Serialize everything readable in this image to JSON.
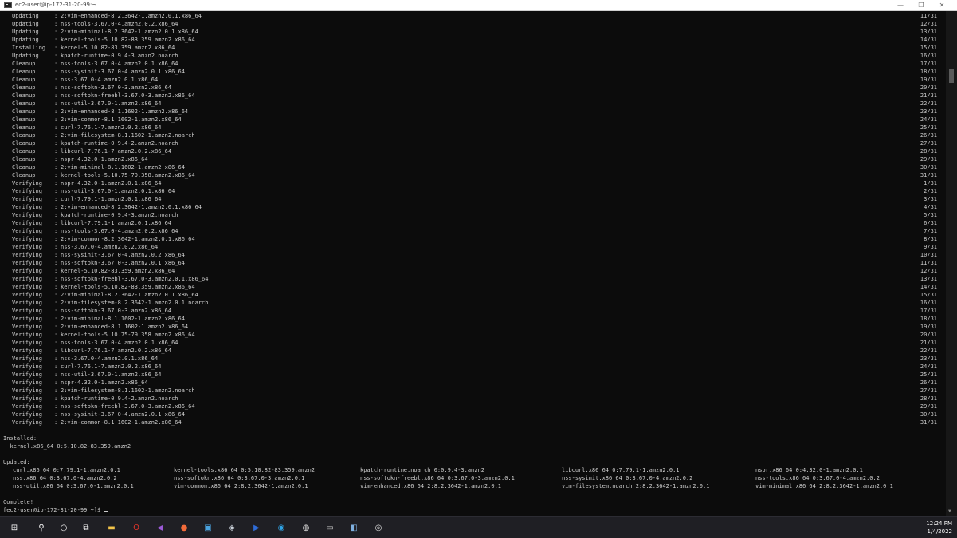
{
  "window": {
    "title": "ec2-user@ip-172-31-20-99:~",
    "minimize_label": "—",
    "maximize_label": "❐",
    "close_label": "✕"
  },
  "terminal": {
    "lines": [
      {
        "action": "Updating",
        "pkg": "2:vim-enhanced-8.2.3642-1.amzn2.0.1.x86_64",
        "count": "11/31"
      },
      {
        "action": "Updating",
        "pkg": "nss-tools-3.67.0-4.amzn2.0.2.x86_64",
        "count": "12/31"
      },
      {
        "action": "Updating",
        "pkg": "2:vim-minimal-8.2.3642-1.amzn2.0.1.x86_64",
        "count": "13/31"
      },
      {
        "action": "Updating",
        "pkg": "kernel-tools-5.10.82-83.359.amzn2.x86_64",
        "count": "14/31"
      },
      {
        "action": "Installing",
        "pkg": "kernel-5.10.82-83.359.amzn2.x86_64",
        "count": "15/31"
      },
      {
        "action": "Updating",
        "pkg": "kpatch-runtime-0.9.4-3.amzn2.noarch",
        "count": "16/31"
      },
      {
        "action": "Cleanup",
        "pkg": "nss-tools-3.67.0-4.amzn2.0.1.x86_64",
        "count": "17/31"
      },
      {
        "action": "Cleanup",
        "pkg": "nss-sysinit-3.67.0-4.amzn2.0.1.x86_64",
        "count": "18/31"
      },
      {
        "action": "Cleanup",
        "pkg": "nss-3.67.0-4.amzn2.0.1.x86_64",
        "count": "19/31"
      },
      {
        "action": "Cleanup",
        "pkg": "nss-softokn-3.67.0-3.amzn2.x86_64",
        "count": "20/31"
      },
      {
        "action": "Cleanup",
        "pkg": "nss-softokn-freebl-3.67.0-3.amzn2.x86_64",
        "count": "21/31"
      },
      {
        "action": "Cleanup",
        "pkg": "nss-util-3.67.0-1.amzn2.x86_64",
        "count": "22/31"
      },
      {
        "action": "Cleanup",
        "pkg": "2:vim-enhanced-8.1.1602-1.amzn2.x86_64",
        "count": "23/31"
      },
      {
        "action": "Cleanup",
        "pkg": "2:vim-common-8.1.1602-1.amzn2.x86_64",
        "count": "24/31"
      },
      {
        "action": "Cleanup",
        "pkg": "curl-7.76.1-7.amzn2.0.2.x86_64",
        "count": "25/31"
      },
      {
        "action": "Cleanup",
        "pkg": "2:vim-filesystem-8.1.1602-1.amzn2.noarch",
        "count": "26/31"
      },
      {
        "action": "Cleanup",
        "pkg": "kpatch-runtime-0.9.4-2.amzn2.noarch",
        "count": "27/31"
      },
      {
        "action": "Cleanup",
        "pkg": "libcurl-7.76.1-7.amzn2.0.2.x86_64",
        "count": "28/31"
      },
      {
        "action": "Cleanup",
        "pkg": "nspr-4.32.0-1.amzn2.x86_64",
        "count": "29/31"
      },
      {
        "action": "Cleanup",
        "pkg": "2:vim-minimal-8.1.1602-1.amzn2.x86_64",
        "count": "30/31"
      },
      {
        "action": "Cleanup",
        "pkg": "kernel-tools-5.10.75-79.358.amzn2.x86_64",
        "count": "31/31"
      },
      {
        "action": "Verifying",
        "pkg": "nspr-4.32.0-1.amzn2.0.1.x86_64",
        "count": "1/31"
      },
      {
        "action": "Verifying",
        "pkg": "nss-util-3.67.0-1.amzn2.0.1.x86_64",
        "count": "2/31"
      },
      {
        "action": "Verifying",
        "pkg": "curl-7.79.1-1.amzn2.0.1.x86_64",
        "count": "3/31"
      },
      {
        "action": "Verifying",
        "pkg": "2:vim-enhanced-8.2.3642-1.amzn2.0.1.x86_64",
        "count": "4/31"
      },
      {
        "action": "Verifying",
        "pkg": "kpatch-runtime-0.9.4-3.amzn2.noarch",
        "count": "5/31"
      },
      {
        "action": "Verifying",
        "pkg": "libcurl-7.79.1-1.amzn2.0.1.x86_64",
        "count": "6/31"
      },
      {
        "action": "Verifying",
        "pkg": "nss-tools-3.67.0-4.amzn2.0.2.x86_64",
        "count": "7/31"
      },
      {
        "action": "Verifying",
        "pkg": "2:vim-common-8.2.3642-1.amzn2.0.1.x86_64",
        "count": "8/31"
      },
      {
        "action": "Verifying",
        "pkg": "nss-3.67.0-4.amzn2.0.2.x86_64",
        "count": "9/31"
      },
      {
        "action": "Verifying",
        "pkg": "nss-sysinit-3.67.0-4.amzn2.0.2.x86_64",
        "count": "10/31"
      },
      {
        "action": "Verifying",
        "pkg": "nss-softokn-3.67.0-3.amzn2.0.1.x86_64",
        "count": "11/31"
      },
      {
        "action": "Verifying",
        "pkg": "kernel-5.10.82-83.359.amzn2.x86_64",
        "count": "12/31"
      },
      {
        "action": "Verifying",
        "pkg": "nss-softokn-freebl-3.67.0-3.amzn2.0.1.x86_64",
        "count": "13/31"
      },
      {
        "action": "Verifying",
        "pkg": "kernel-tools-5.10.82-83.359.amzn2.x86_64",
        "count": "14/31"
      },
      {
        "action": "Verifying",
        "pkg": "2:vim-minimal-8.2.3642-1.amzn2.0.1.x86_64",
        "count": "15/31"
      },
      {
        "action": "Verifying",
        "pkg": "2:vim-filesystem-8.2.3642-1.amzn2.0.1.noarch",
        "count": "16/31"
      },
      {
        "action": "Verifying",
        "pkg": "nss-softokn-3.67.0-3.amzn2.x86_64",
        "count": "17/31"
      },
      {
        "action": "Verifying",
        "pkg": "2:vim-minimal-8.1.1602-1.amzn2.x86_64",
        "count": "18/31"
      },
      {
        "action": "Verifying",
        "pkg": "2:vim-enhanced-8.1.1602-1.amzn2.x86_64",
        "count": "19/31"
      },
      {
        "action": "Verifying",
        "pkg": "kernel-tools-5.10.75-79.358.amzn2.x86_64",
        "count": "20/31"
      },
      {
        "action": "Verifying",
        "pkg": "nss-tools-3.67.0-4.amzn2.0.1.x86_64",
        "count": "21/31"
      },
      {
        "action": "Verifying",
        "pkg": "libcurl-7.76.1-7.amzn2.0.2.x86_64",
        "count": "22/31"
      },
      {
        "action": "Verifying",
        "pkg": "nss-3.67.0-4.amzn2.0.1.x86_64",
        "count": "23/31"
      },
      {
        "action": "Verifying",
        "pkg": "curl-7.76.1-7.amzn2.0.2.x86_64",
        "count": "24/31"
      },
      {
        "action": "Verifying",
        "pkg": "nss-util-3.67.0-1.amzn2.x86_64",
        "count": "25/31"
      },
      {
        "action": "Verifying",
        "pkg": "nspr-4.32.0-1.amzn2.x86_64",
        "count": "26/31"
      },
      {
        "action": "Verifying",
        "pkg": "2:vim-filesystem-8.1.1602-1.amzn2.noarch",
        "count": "27/31"
      },
      {
        "action": "Verifying",
        "pkg": "kpatch-runtime-0.9.4-2.amzn2.noarch",
        "count": "28/31"
      },
      {
        "action": "Verifying",
        "pkg": "nss-softokn-freebl-3.67.0-3.amzn2.x86_64",
        "count": "29/31"
      },
      {
        "action": "Verifying",
        "pkg": "nss-sysinit-3.67.0-4.amzn2.0.1.x86_64",
        "count": "30/31"
      },
      {
        "action": "Verifying",
        "pkg": "2:vim-common-8.1.1602-1.amzn2.x86_64",
        "count": "31/31"
      }
    ],
    "installed_header": "Installed:",
    "installed": "  kernel.x86_64 0:5.10.82-83.359.amzn2",
    "updated_header": "Updated:",
    "updated_rows": [
      [
        "curl.x86_64 0:7.79.1-1.amzn2.0.1",
        "kernel-tools.x86_64 0:5.10.82-83.359.amzn2",
        "kpatch-runtime.noarch 0:0.9.4-3.amzn2",
        "libcurl.x86_64 0:7.79.1-1.amzn2.0.1",
        "nspr.x86_64 0:4.32.0-1.amzn2.0.1"
      ],
      [
        "nss.x86_64 0:3.67.0-4.amzn2.0.2",
        "nss-softokn.x86_64 0:3.67.0-3.amzn2.0.1",
        "nss-softokn-freebl.x86_64 0:3.67.0-3.amzn2.0.1",
        "nss-sysinit.x86_64 0:3.67.0-4.amzn2.0.2",
        "nss-tools.x86_64 0:3.67.0-4.amzn2.0.2"
      ],
      [
        "nss-util.x86_64 0:3.67.0-1.amzn2.0.1",
        "vim-common.x86_64 2:8.2.3642-1.amzn2.0.1",
        "vim-enhanced.x86_64 2:8.2.3642-1.amzn2.0.1",
        "vim-filesystem.noarch 2:8.2.3642-1.amzn2.0.1",
        "vim-minimal.x86_64 2:8.2.3642-1.amzn2.0.1"
      ]
    ],
    "complete": "Complete!",
    "prompt": "[ec2-user@ip-172-31-20-99 ~]$ "
  },
  "taskbar": {
    "icons": [
      {
        "name": "windows-start-icon",
        "glyph": "⊞",
        "color": "#ffffff",
        "interactable": true
      },
      {
        "name": "search-icon",
        "glyph": "⚲",
        "color": "#ffffff",
        "interactable": true
      },
      {
        "name": "cortana-icon",
        "glyph": "○",
        "color": "#ffffff",
        "interactable": true
      },
      {
        "name": "task-view-icon",
        "glyph": "⧉",
        "color": "#ffffff",
        "interactable": true
      },
      {
        "name": "file-explorer-icon",
        "glyph": "▬",
        "color": "#f3c44a",
        "interactable": true
      },
      {
        "name": "opera-icon",
        "glyph": "O",
        "color": "#e8342a",
        "interactable": true
      },
      {
        "name": "visual-studio-icon",
        "glyph": "◀",
        "color": "#9b59d6",
        "interactable": true
      },
      {
        "name": "postman-icon",
        "glyph": "●",
        "color": "#f26b3a",
        "interactable": true
      },
      {
        "name": "remote-desktop-icon",
        "glyph": "▣",
        "color": "#4aa3df",
        "interactable": true
      },
      {
        "name": "virtualbox-icon",
        "glyph": "◈",
        "color": "#cfd6df",
        "interactable": true
      },
      {
        "name": "powershell-icon",
        "glyph": "▶",
        "color": "#2e6bd6",
        "interactable": true
      },
      {
        "name": "edge-icon",
        "glyph": "◉",
        "color": "#2fa4e7",
        "interactable": true
      },
      {
        "name": "chrome-icon",
        "glyph": "◍",
        "color": "#e8e8e8",
        "interactable": true
      },
      {
        "name": "terminal-icon",
        "glyph": "▭",
        "color": "#d0d0d0",
        "interactable": true
      },
      {
        "name": "notes-app-icon",
        "glyph": "◧",
        "color": "#7fb0e0",
        "interactable": true
      },
      {
        "name": "obs-icon",
        "glyph": "◎",
        "color": "#e0e0e0",
        "interactable": true
      }
    ],
    "time": "12:24 PM",
    "date": "1/4/2022"
  }
}
